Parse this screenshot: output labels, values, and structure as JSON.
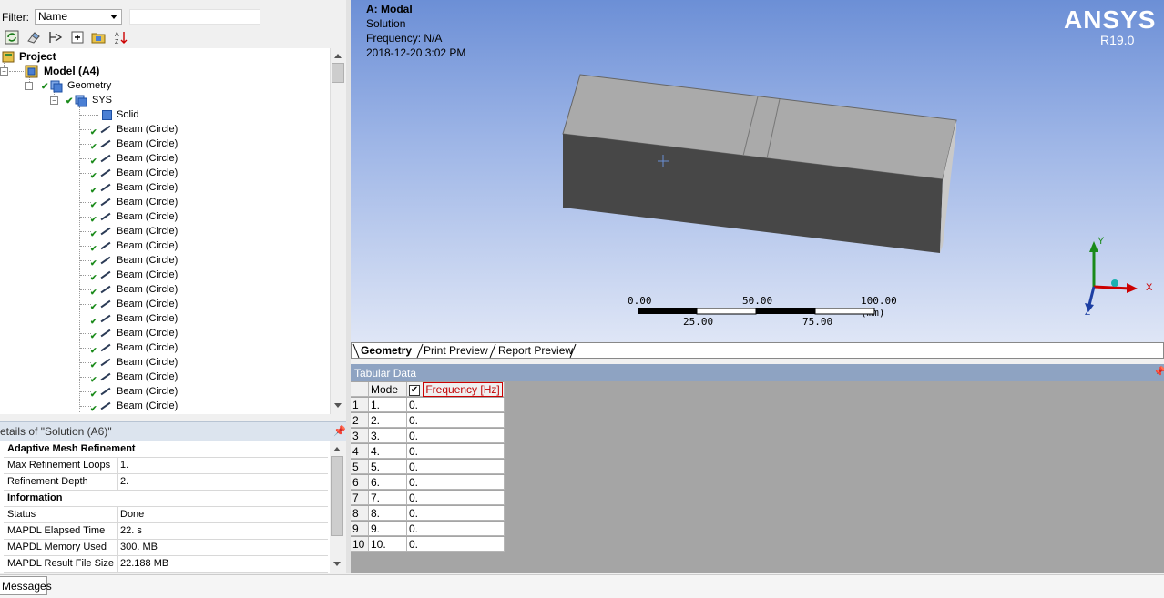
{
  "filter": {
    "label": "Filter:",
    "selected": "Name",
    "search_value": ""
  },
  "tree": {
    "project": "Project",
    "model": "Model (A4)",
    "geometry": "Geometry",
    "sys": "SYS",
    "solid": "Solid",
    "beams": [
      "Beam (Circle)",
      "Beam (Circle)",
      "Beam (Circle)",
      "Beam (Circle)",
      "Beam (Circle)",
      "Beam (Circle)",
      "Beam (Circle)",
      "Beam (Circle)",
      "Beam (Circle)",
      "Beam (Circle)",
      "Beam (Circle)",
      "Beam (Circle)",
      "Beam (Circle)",
      "Beam (Circle)",
      "Beam (Circle)",
      "Beam (Circle)",
      "Beam (Circle)",
      "Beam (Circle)",
      "Beam (Circle)",
      "Beam (Circle)"
    ]
  },
  "details": {
    "title": "etails of \"Solution (A6)\"",
    "rows": [
      {
        "type": "category",
        "label": "Adaptive Mesh Refinement"
      },
      {
        "type": "prop",
        "key": "Max Refinement Loops",
        "value": "1."
      },
      {
        "type": "prop",
        "key": "Refinement Depth",
        "value": "2."
      },
      {
        "type": "category",
        "label": "Information"
      },
      {
        "type": "prop",
        "key": "Status",
        "value": "Done"
      },
      {
        "type": "prop",
        "key": "MAPDL Elapsed Time",
        "value": "22. s"
      },
      {
        "type": "prop",
        "key": "MAPDL Memory Used",
        "value": "300. MB"
      },
      {
        "type": "prop",
        "key": "MAPDL Result File Size",
        "value": "22.188 MB"
      }
    ]
  },
  "viewport": {
    "title": "A: Modal",
    "line2": "Solution",
    "line3": "Frequency: N/A",
    "line4": "2018-12-20 3:02 PM",
    "logo": "ANSYS",
    "version": "R19.0",
    "scale": {
      "top": [
        "0.00",
        "50.00",
        "100.00 (mm)"
      ],
      "bottom": [
        "25.00",
        "75.00"
      ]
    },
    "triad": {
      "x": "X",
      "y": "Y",
      "z": "Z"
    }
  },
  "tabs": [
    "Geometry",
    "Print Preview",
    "Report Preview"
  ],
  "tabular": {
    "title": "Tabular Data",
    "col_mode": "Mode",
    "col_freq": "Frequency [Hz]",
    "rows": [
      {
        "i": "1",
        "mode": "1.",
        "freq": "0."
      },
      {
        "i": "2",
        "mode": "2.",
        "freq": "0."
      },
      {
        "i": "3",
        "mode": "3.",
        "freq": "0."
      },
      {
        "i": "4",
        "mode": "4.",
        "freq": "0."
      },
      {
        "i": "5",
        "mode": "5.",
        "freq": "0."
      },
      {
        "i": "6",
        "mode": "6.",
        "freq": "0."
      },
      {
        "i": "7",
        "mode": "7.",
        "freq": "0."
      },
      {
        "i": "8",
        "mode": "8.",
        "freq": "0."
      },
      {
        "i": "9",
        "mode": "9.",
        "freq": "0."
      },
      {
        "i": "10",
        "mode": "10.",
        "freq": "0."
      }
    ]
  },
  "status": {
    "messages_tab": "Messages"
  },
  "colors": {
    "accent_header": "#8ea3c2",
    "freq_header": "#c00000"
  }
}
